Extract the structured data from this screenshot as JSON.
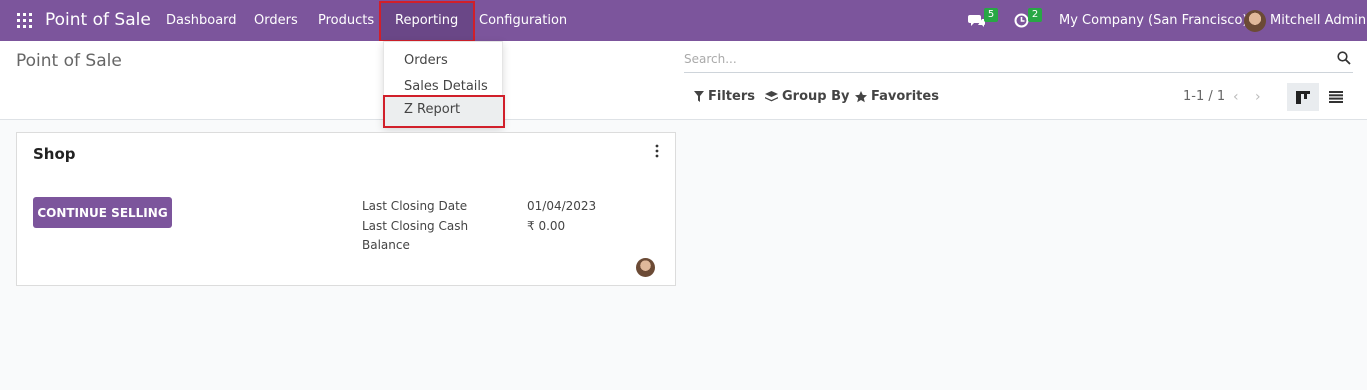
{
  "navbar": {
    "brand": "Point of Sale",
    "menu": {
      "dashboard": "Dashboard",
      "orders": "Orders",
      "products": "Products",
      "reporting": "Reporting",
      "configuration": "Configuration"
    },
    "messages_count": "5",
    "activities_count": "2",
    "company": "My Company (San Francisco)",
    "user": "Mitchell Admin"
  },
  "reporting_dropdown": {
    "items": [
      "Orders",
      "Sales Details",
      "Z Report"
    ],
    "highlighted": "Z Report"
  },
  "control_panel": {
    "breadcrumb": "Point of Sale",
    "search_placeholder": "Search...",
    "filters": "Filters",
    "group_by": "Group By",
    "favorites": "Favorites",
    "pager": "1-1 / 1"
  },
  "card": {
    "title": "Shop",
    "button": "CONTINUE SELLING",
    "last_closing_date_label": "Last Closing Date",
    "last_closing_date": "01/04/2023",
    "last_closing_cash_label_1": "Last Closing Cash",
    "last_closing_cash_label_2": "Balance",
    "last_closing_cash": "₹ 0.00"
  },
  "colors": {
    "navbar": "#7c559c",
    "badge": "#28a745",
    "highlight_border": "#d11f2a"
  },
  "icons": [
    "apps-icon",
    "chat-icon",
    "clock-icon",
    "search-icon",
    "filter-icon",
    "layers-icon",
    "star-icon",
    "chevron-left-icon",
    "chevron-right-icon",
    "kanban-icon",
    "list-icon",
    "kebab-menu-icon"
  ]
}
